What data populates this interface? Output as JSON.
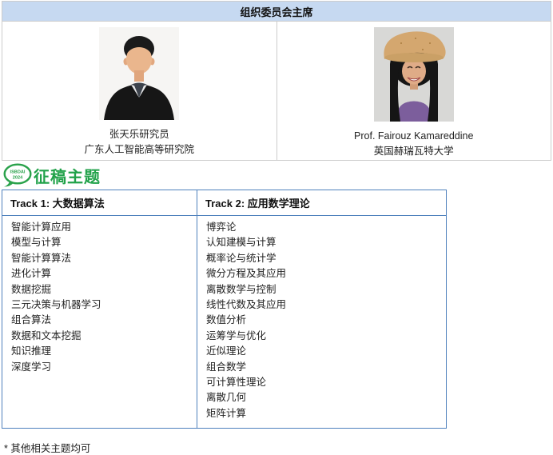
{
  "committee": {
    "title": "组织委员会主席",
    "members": [
      {
        "name": "张天乐研究员",
        "affiliation": "广东人工智能高等研究院"
      },
      {
        "name": "Prof. Fairouz Kamareddine",
        "affiliation": "英国赫瑞瓦特大学"
      }
    ]
  },
  "topics_section": {
    "logo": {
      "line1": "ISBDAI",
      "line2": "2024"
    },
    "title": "征稿主题",
    "tracks": [
      {
        "header": "Track 1: 大数据算法",
        "items": [
          "智能计算应用",
          "模型与计算",
          "智能计算算法",
          "进化计算",
          "数据挖掘",
          "三元决策与机器学习",
          "组合算法",
          "数据和文本挖掘",
          "知识推理",
          "深度学习"
        ]
      },
      {
        "header": "Track 2: 应用数学理论",
        "items": [
          "博弈论",
          "认知建模与计算",
          "概率论与统计学",
          "微分方程及其应用",
          "离散数学与控制",
          "线性代数及其应用",
          "数值分析",
          "运筹学与优化",
          "近似理论",
          "组合数学",
          "可计算性理论",
          "离散几何",
          "矩阵计算"
        ]
      }
    ],
    "footnote": "* 其他相关主题均可"
  },
  "colors": {
    "committee_header_bg": "#c6d9f1",
    "committee_border": "#cccccc",
    "tracks_border": "#4f81bd",
    "section_title_green": "#21a24a"
  }
}
